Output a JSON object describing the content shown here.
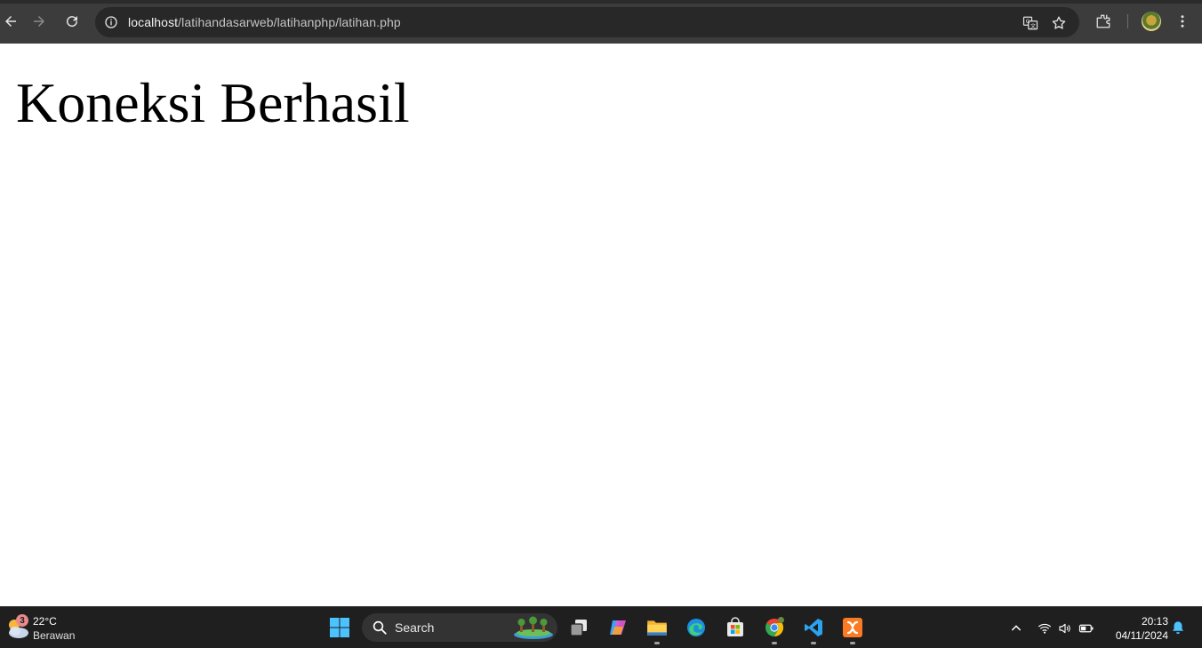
{
  "browser": {
    "url_host": "localhost",
    "url_path": "/latihandasarweb/latihanphp/latihan.php",
    "icons": [
      "back-icon",
      "forward-icon",
      "reload-icon",
      "site-info-icon",
      "translate-icon",
      "bookmark-star-icon",
      "extensions-icon",
      "profile-avatar",
      "menu-dots-icon"
    ]
  },
  "page": {
    "heading": "Koneksi Berhasil"
  },
  "taskbar": {
    "weather": {
      "badge": "3",
      "temperature": "22°C",
      "condition": "Berawan"
    },
    "search": {
      "label": "Search"
    },
    "apps": [
      "start-button",
      "task-view",
      "copilot",
      "file-explorer",
      "edge",
      "microsoft-store",
      "chrome",
      "vscode",
      "xampp"
    ],
    "clock": {
      "time": "20:13",
      "date": "04/11/2024"
    },
    "accent_color": "#4cc2ff"
  }
}
